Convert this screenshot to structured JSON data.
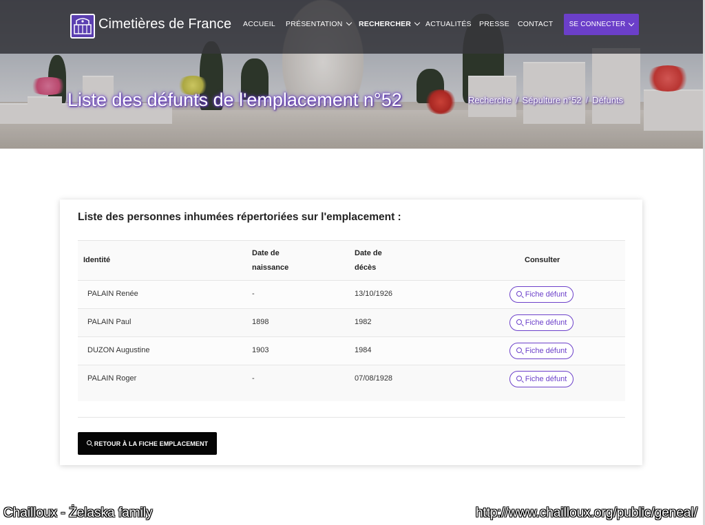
{
  "header": {
    "brand": "Cimetières de France",
    "nav": [
      {
        "label": "ACCUEIL",
        "dropdown": false,
        "active": false
      },
      {
        "label": "PRÉSENTATION",
        "dropdown": true,
        "active": false
      },
      {
        "label": "RECHERCHER",
        "dropdown": true,
        "active": true
      },
      {
        "label": "ACTUALITÉS",
        "dropdown": false,
        "active": false
      },
      {
        "label": "PRESSE",
        "dropdown": false,
        "active": false
      },
      {
        "label": "CONTACT",
        "dropdown": false,
        "active": false
      }
    ],
    "login_label": "SE CONNECTER",
    "accent_color": "#6b3fc9"
  },
  "hero": {
    "title": "Liste des défunts de l'emplacement n°52",
    "breadcrumb": [
      "Recherche",
      "Sépulture n°52",
      "Défunts"
    ],
    "separator": "/"
  },
  "card": {
    "heading": "Liste des personnes inhumées répertoriées sur l'emplacement :",
    "columns": {
      "identity": "Identité",
      "birth_line1": "Date de",
      "birth_line2": "naissance",
      "death_line1": "Date de",
      "death_line2": "décès",
      "consult": "Consulter"
    },
    "rows": [
      {
        "identity": "PALAIN Renée",
        "birth": "-",
        "death": "13/10/1926",
        "action": "Fiche défunt"
      },
      {
        "identity": "PALAIN Paul",
        "birth": "1898",
        "death": "1982",
        "action": "Fiche défunt"
      },
      {
        "identity": "DUZON Augustine",
        "birth": "1903",
        "death": "1984",
        "action": "Fiche défunt"
      },
      {
        "identity": "PALAIN Roger",
        "birth": "-",
        "death": "07/08/1928",
        "action": "Fiche défunt"
      }
    ],
    "back_label": "RETOUR À LA FICHE EMPLACEMENT"
  },
  "captions": {
    "left": "Chailloux - Żelaska  family",
    "right": "http://www.chailloux.org/public/geneal/"
  }
}
